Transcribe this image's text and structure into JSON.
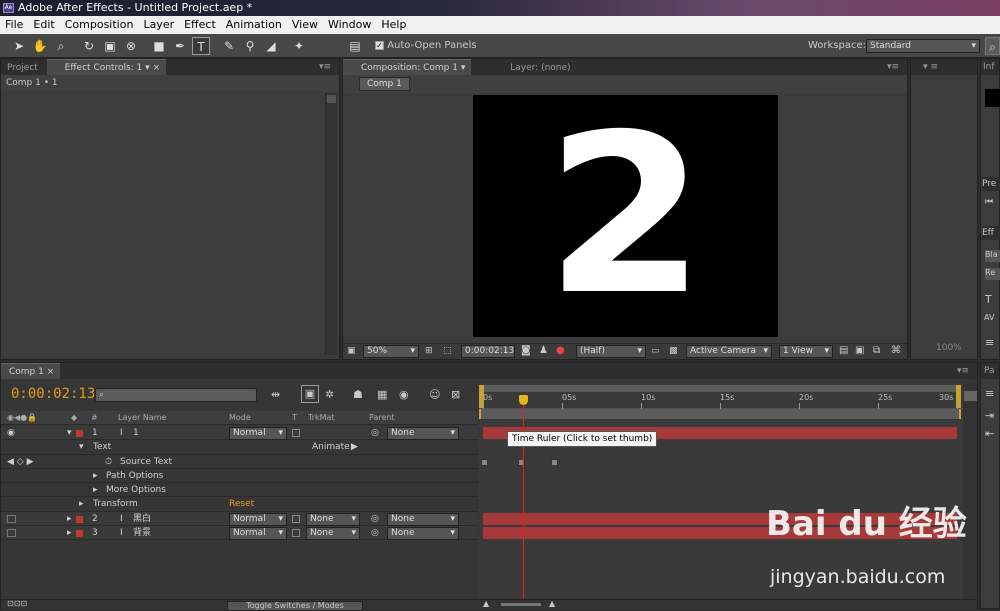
{
  "app": {
    "title": "Adobe After Effects - Untitled Project.aep *",
    "icon": "ae-icon"
  },
  "menu": [
    "File",
    "Edit",
    "Composition",
    "Layer",
    "Effect",
    "Animation",
    "View",
    "Window",
    "Help"
  ],
  "toolbar": {
    "tools": [
      "selection-tool-icon",
      "hand-tool-icon",
      "zoom-tool-icon",
      "rotation-tool-icon",
      "camera-tool-icon",
      "pan-behind-tool-icon",
      "rectangle-mask-icon",
      "pen-tool-icon",
      "type-tool-icon",
      "brush-tool-icon",
      "clone-stamp-icon",
      "eraser-icon",
      "puppet-pin-icon"
    ],
    "auto_open_label": "Auto-Open Panels",
    "auto_open_checked": true,
    "workspace_label": "Workspace:",
    "workspace_value": "Standard"
  },
  "left_panel": {
    "tab_project": "Project",
    "tab_effect_controls": "Effect Controls: 1",
    "header": "Comp 1 • 1"
  },
  "comp_panel": {
    "tab_comp": "Composition: Comp 1",
    "tab_layer": "Layer: (none)",
    "subtab": "Comp 1",
    "canvas_text": "2",
    "zoom": "50%",
    "timecode": "0:00:02:13",
    "resolution": "(Half)",
    "camera": "Active Camera",
    "view": "1 View"
  },
  "right_panel": {
    "tab_info": "Inf",
    "tab_preview": "Pre",
    "tab_effects": "Eff",
    "item1": "Bla",
    "item2": "Re",
    "tab_paragraph": "Pa",
    "zoom": "100%"
  },
  "timeline": {
    "tab": "Comp 1",
    "timecode": "0:00:02:13",
    "search_placeholder": "",
    "columns": {
      "layer_name": "Layer Name",
      "mode": "Mode",
      "t": "T",
      "trkmat": "TrkMat",
      "parent": "Parent",
      "num": "#"
    },
    "layers": [
      {
        "num": "1",
        "name": "1",
        "mode": "Normal",
        "trkmat": "",
        "parent": "None",
        "color": "#c0392b"
      },
      {
        "num": "2",
        "name": "黑白",
        "mode": "Normal",
        "trkmat": "None",
        "parent": "None",
        "color": "#c0392b"
      },
      {
        "num": "3",
        "name": "背景",
        "mode": "Normal",
        "trkmat": "None",
        "parent": "None",
        "color": "#c0392b"
      }
    ],
    "text_group": "Text",
    "animate_label": "Animate:",
    "source_text": "Source Text",
    "path_options": "Path Options",
    "more_options": "More Options",
    "transform": "Transform",
    "reset": "Reset",
    "ruler": [
      "0s",
      "05s",
      "10s",
      "15s",
      "20s",
      "25s",
      "30s"
    ],
    "tooltip": "Time Ruler (Click to set thumb)",
    "toggle_label": "Toggle Switches / Modes",
    "playhead_seconds": 2.54
  },
  "watermark": {
    "brand": "Bai du 经验",
    "url": "jingyan.baidu.com"
  },
  "colors": {
    "accent": "#e49b1c",
    "layer_bar": "#a63a3a",
    "playhead": "#e02020"
  }
}
